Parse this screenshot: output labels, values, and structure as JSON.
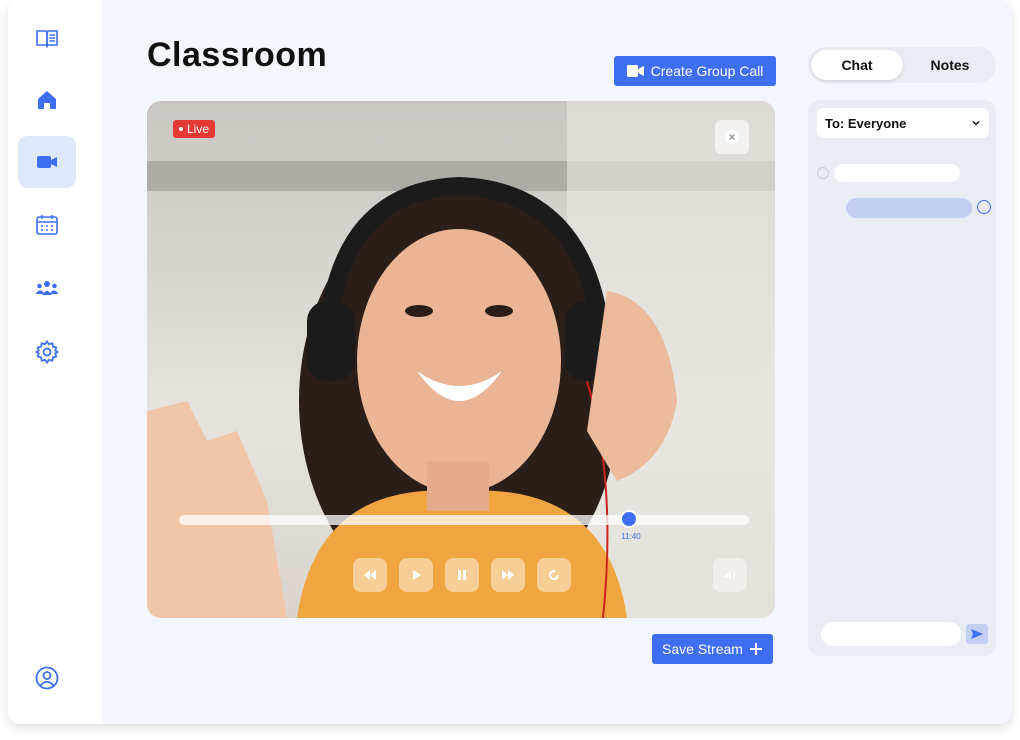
{
  "page": {
    "title": "Classroom"
  },
  "sidebar": {
    "items": [
      {
        "name": "courses",
        "icon": "open-book-icon",
        "active": false
      },
      {
        "name": "home",
        "icon": "home-icon",
        "active": false
      },
      {
        "name": "video",
        "icon": "video-camera-icon",
        "active": true
      },
      {
        "name": "calendar",
        "icon": "calendar-icon",
        "active": false
      },
      {
        "name": "groups",
        "icon": "group-icon",
        "active": false
      },
      {
        "name": "settings",
        "icon": "gear-icon",
        "active": false
      }
    ],
    "profile_icon": "user-circle-icon"
  },
  "toolbar": {
    "create_group_call_label": "Create Group Call"
  },
  "video": {
    "live_label": "Live",
    "progress": 0.79,
    "time_label": "11:40",
    "controls": [
      "rewind-icon",
      "play-icon",
      "pause-icon",
      "fast-forward-icon",
      "replay-icon",
      "volume-icon"
    ]
  },
  "actions": {
    "save_stream_label": "Save Stream"
  },
  "chat": {
    "tabs": [
      {
        "label": "Chat",
        "active": true
      },
      {
        "label": "Notes",
        "active": false
      }
    ],
    "recipient": "To: Everyone",
    "send_icon": "send-icon"
  },
  "colors": {
    "accent": "#3e6ef1",
    "live": "#e53935",
    "panel": "#e9ecf2",
    "background": "#f3f6fc"
  }
}
